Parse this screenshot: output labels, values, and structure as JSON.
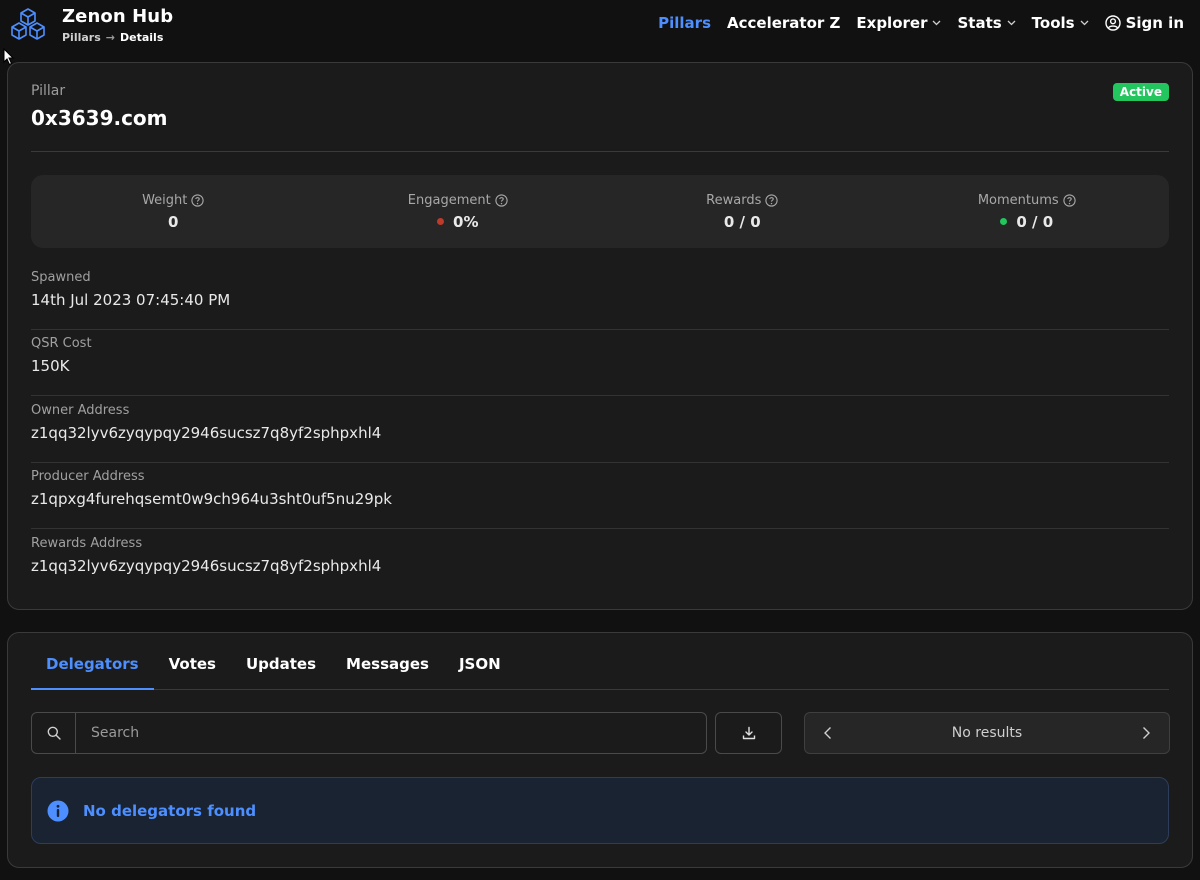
{
  "header": {
    "brand": "Zenon Hub",
    "breadcrumb": [
      {
        "label": "Pillars"
      },
      {
        "label": "Details"
      }
    ],
    "nav": {
      "pillars": "Pillars",
      "accelerator": "Accelerator Z",
      "explorer": "Explorer",
      "stats": "Stats",
      "tools": "Tools",
      "sign_in": "Sign in"
    }
  },
  "pillar": {
    "label": "Pillar",
    "name": "0x3639.com",
    "status": "Active",
    "stats": {
      "weight": {
        "label": "Weight",
        "value": "0"
      },
      "engagement": {
        "label": "Engagement",
        "value": "0%",
        "dot_color": "#c0392b"
      },
      "rewards": {
        "label": "Rewards",
        "value": "0 / 0"
      },
      "momentums": {
        "label": "Momentums",
        "value": "0 / 0",
        "dot_color": "#22c55e"
      }
    },
    "fields": {
      "spawned": {
        "label": "Spawned",
        "value": "14th Jul 2023 07:45:40 PM"
      },
      "qsr_cost": {
        "label": "QSR Cost",
        "value": "150K"
      },
      "owner": {
        "label": "Owner Address",
        "value": "z1qq32lyv6zyqypqy2946sucsz7q8yf2sphpxhl4"
      },
      "producer": {
        "label": "Producer Address",
        "value": "z1qpxg4furehqsemt0w9ch964u3sht0uf5nu29pk"
      },
      "rewards_addr": {
        "label": "Rewards Address",
        "value": "z1qq32lyv6zyqypqy2946sucsz7q8yf2sphpxhl4"
      }
    }
  },
  "tabs": {
    "delegators": "Delegators",
    "votes": "Votes",
    "updates": "Updates",
    "messages": "Messages",
    "json": "JSON"
  },
  "toolbar": {
    "search_placeholder": "Search",
    "pager_text": "No results"
  },
  "alert": {
    "message": "No delegators found"
  },
  "colors": {
    "accent": "#4d8fff",
    "active_badge": "#22c55e",
    "background": "#111111",
    "card": "#1b1b1b"
  },
  "icons": [
    "cube-logo-icon",
    "chevron-down-icon",
    "user-circle-icon",
    "help-circle-icon",
    "search-icon",
    "download-icon",
    "chevron-left-icon",
    "chevron-right-icon",
    "info-icon",
    "mouse-cursor-icon"
  ]
}
